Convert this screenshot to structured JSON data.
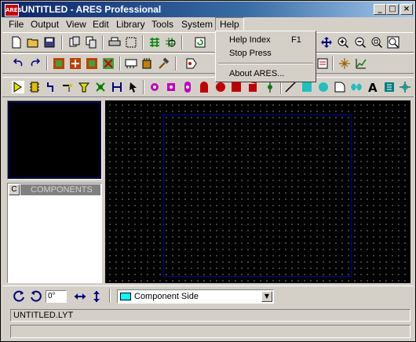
{
  "window": {
    "title": "UNTITLED - ARES Professional",
    "icon_text": "ARES"
  },
  "title_buttons": {
    "minimize": "_",
    "maximize": "□",
    "close": "×"
  },
  "menubar": {
    "items": [
      {
        "label": "File"
      },
      {
        "label": "Output"
      },
      {
        "label": "View"
      },
      {
        "label": "Edit"
      },
      {
        "label": "Library"
      },
      {
        "label": "Tools"
      },
      {
        "label": "System"
      },
      {
        "label": "Help"
      }
    ]
  },
  "help_menu": {
    "items": [
      {
        "label": "Help Index",
        "shortcut": "F1"
      },
      {
        "label": "Stop Press",
        "shortcut": ""
      },
      {
        "label": "About ARES...",
        "shortcut": ""
      }
    ]
  },
  "selector": {
    "mode_button": "C",
    "header": "COMPONENTS"
  },
  "bottom": {
    "angle_value": "0°",
    "layer_selected": "Component Side",
    "layer_color": "#00ffff"
  },
  "status": {
    "filename": "UNTITLED.LYT"
  },
  "colors": {
    "titlebar_start": "#0a246a",
    "canvas_bg": "#000000",
    "board_outline": "#0000a0",
    "grid_dot": "#7a7a7a"
  }
}
